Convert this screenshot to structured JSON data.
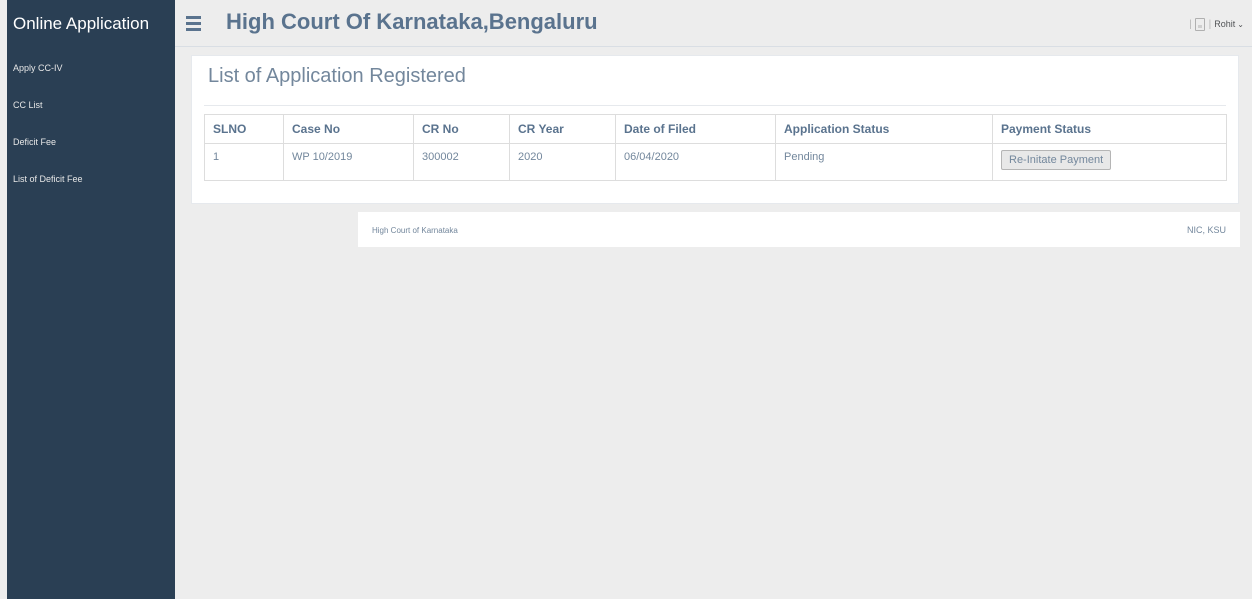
{
  "sidebar": {
    "brand": "Online Application",
    "items": [
      {
        "label": "Apply CC-IV"
      },
      {
        "label": "CC List"
      },
      {
        "label": "Deficit Fee"
      },
      {
        "label": "List of Deficit Fee"
      }
    ]
  },
  "header": {
    "title": "High Court Of Karnataka,Bengaluru",
    "separator": "|",
    "user_name": "Rohit",
    "icons": [
      "menu-icon",
      "user-icon",
      "chevron-down-icon"
    ]
  },
  "main": {
    "panel_title": "List of Application Registered",
    "table": {
      "columns": [
        "SLNO",
        "Case No",
        "CR No",
        "CR Year",
        "Date of Filed",
        "Application Status",
        "Payment Status"
      ],
      "rows": [
        {
          "slno": "1",
          "case_no": "WP 10/2019",
          "cr_no": "300002",
          "cr_year": "2020",
          "date_filed": "06/04/2020",
          "application_status": "Pending",
          "payment_action": "Re-Initate Payment"
        }
      ]
    }
  },
  "footer": {
    "left": "High Court of Karnataka",
    "right": "NIC, KSU"
  },
  "colors": {
    "sidebar_bg": "#2a3f54",
    "page_bg": "#ededed",
    "title_color": "#5a738e",
    "text_color": "#73879c"
  }
}
